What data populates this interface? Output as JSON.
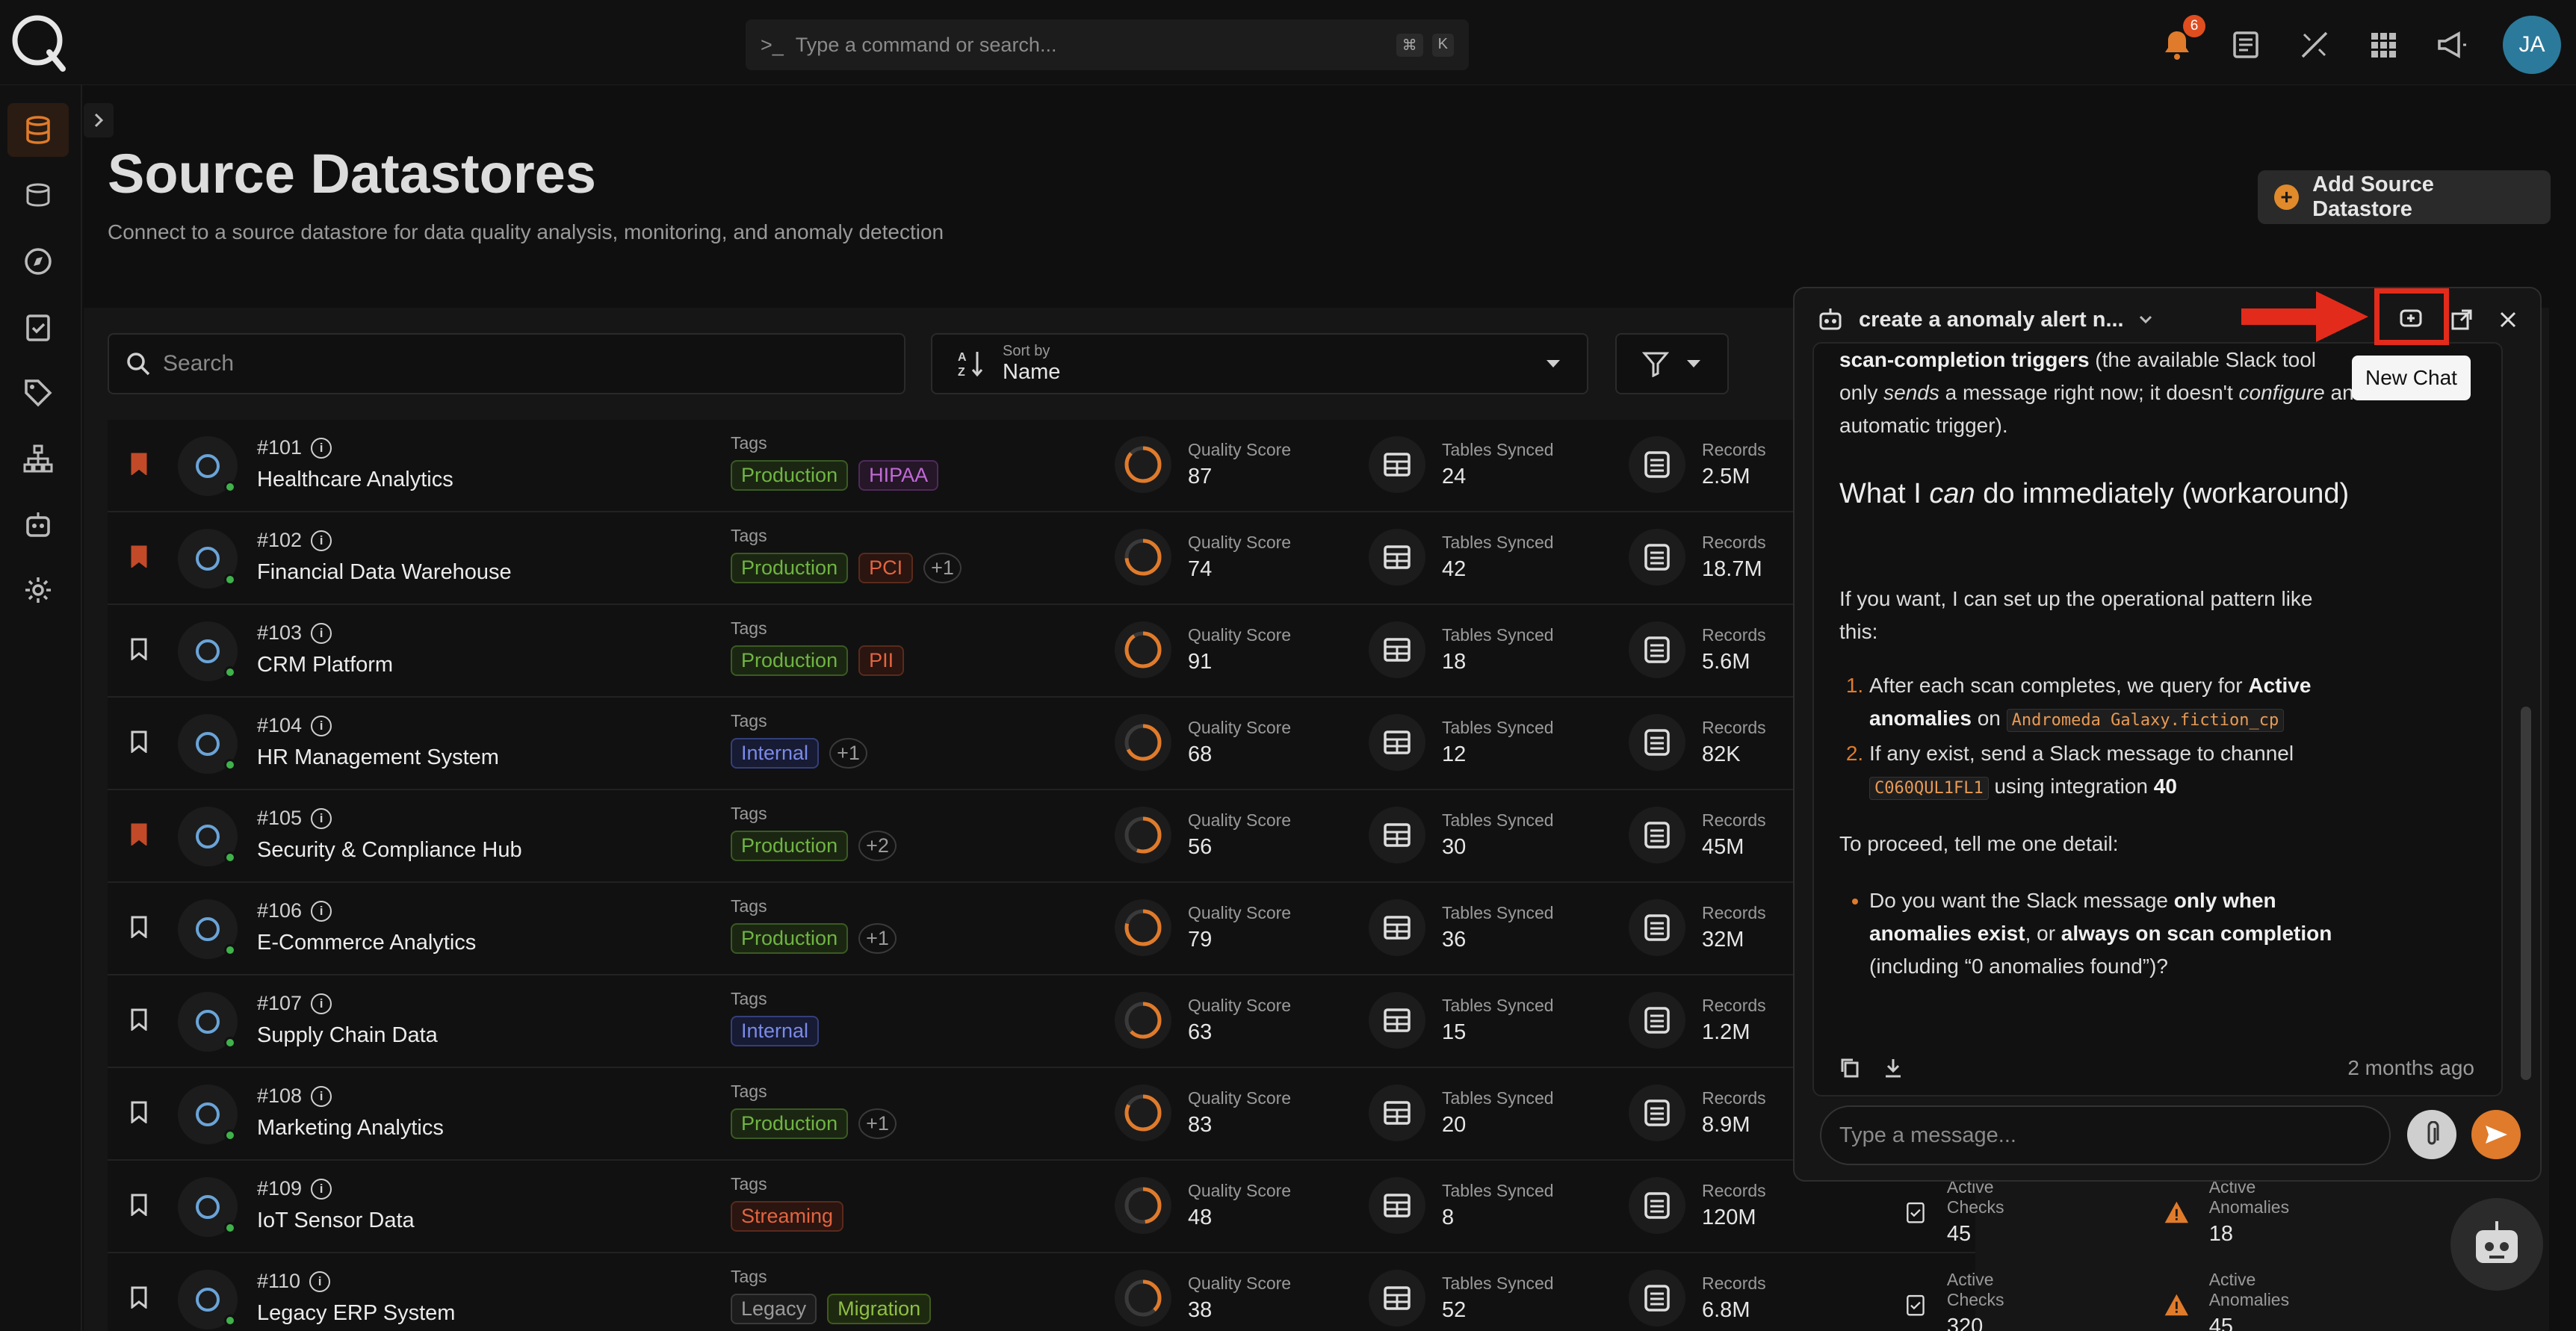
{
  "search": {
    "placeholder": "Type a command or search...",
    "key1": "⌘",
    "key2": "K"
  },
  "notifications": {
    "count": "6"
  },
  "user": {
    "initials": "JA"
  },
  "page": {
    "title": "Source Datastores",
    "subtitle": "Connect to a source datastore for data quality analysis, monitoring, and anomaly detection",
    "add_label": "Add Source Datastore"
  },
  "toolbar": {
    "search_placeholder": "Search",
    "sort_caption": "Sort by",
    "sort_value": "Name"
  },
  "labels": {
    "tags": "Tags",
    "quality": "Quality Score",
    "tables": "Tables Synced",
    "records": "Records",
    "checks": "Active Checks",
    "anomalies": "Active Anomalies"
  },
  "rows": [
    {
      "id": "#101",
      "name": "Healthcare Analytics",
      "bookmarked": true,
      "tags": [
        {
          "t": "Production",
          "c": "prod"
        },
        {
          "t": "HIPAA",
          "c": "hipaa"
        }
      ],
      "quality": "87",
      "tables": "24",
      "records": "2.5M"
    },
    {
      "id": "#102",
      "name": "Financial Data Warehouse",
      "bookmarked": true,
      "tags": [
        {
          "t": "Production",
          "c": "prod"
        },
        {
          "t": "PCI",
          "c": "pci"
        },
        {
          "t": "+1",
          "c": "more"
        }
      ],
      "quality": "74",
      "tables": "42",
      "records": "18.7M"
    },
    {
      "id": "#103",
      "name": "CRM Platform",
      "bookmarked": false,
      "tags": [
        {
          "t": "Production",
          "c": "prod"
        },
        {
          "t": "PII",
          "c": "pii"
        }
      ],
      "quality": "91",
      "tables": "18",
      "records": "5.6M"
    },
    {
      "id": "#104",
      "name": "HR Management System",
      "bookmarked": false,
      "tags": [
        {
          "t": "Internal",
          "c": "internal"
        },
        {
          "t": "+1",
          "c": "more"
        }
      ],
      "quality": "68",
      "tables": "12",
      "records": "82K"
    },
    {
      "id": "#105",
      "name": "Security & Compliance Hub",
      "bookmarked": true,
      "tags": [
        {
          "t": "Production",
          "c": "prod"
        },
        {
          "t": "+2",
          "c": "more"
        }
      ],
      "quality": "56",
      "tables": "30",
      "records": "45M"
    },
    {
      "id": "#106",
      "name": "E-Commerce Analytics",
      "bookmarked": false,
      "tags": [
        {
          "t": "Production",
          "c": "prod"
        },
        {
          "t": "+1",
          "c": "more"
        }
      ],
      "quality": "79",
      "tables": "36",
      "records": "32M"
    },
    {
      "id": "#107",
      "name": "Supply Chain Data",
      "bookmarked": false,
      "tags": [
        {
          "t": "Internal",
          "c": "internal"
        }
      ],
      "quality": "63",
      "tables": "15",
      "records": "1.2M"
    },
    {
      "id": "#108",
      "name": "Marketing Analytics",
      "bookmarked": false,
      "tags": [
        {
          "t": "Production",
          "c": "prod"
        },
        {
          "t": "+1",
          "c": "more"
        }
      ],
      "quality": "83",
      "tables": "20",
      "records": "8.9M"
    },
    {
      "id": "#109",
      "name": "IoT Sensor Data",
      "bookmarked": false,
      "tags": [
        {
          "t": "Streaming",
          "c": "streaming"
        }
      ],
      "quality": "48",
      "tables": "8",
      "records": "120M",
      "checks": "45",
      "anomalies": "18"
    },
    {
      "id": "#110",
      "name": "Legacy ERP System",
      "bookmarked": false,
      "tags": [
        {
          "t": "Legacy",
          "c": "legacy"
        },
        {
          "t": "Migration",
          "c": "migration"
        }
      ],
      "quality": "38",
      "tables": "52",
      "records": "6.8M",
      "checks": "320",
      "anomalies": "45"
    }
  ],
  "chat": {
    "title": "create a anomaly alert n...",
    "p1_b": "scan-completion triggers",
    "p1_a": " (the available Slack tool only ",
    "p1_i": "sends",
    "p1_c": " a message right now; it doesn't ",
    "p1_i2": "configure",
    "p1_d": " an automatic trigger).",
    "h_a": "What I ",
    "h_i": "can",
    "h_b": " do immediately (workaround)",
    "p2": "If you want, I can set up the operational pattern like this:",
    "li1_a": "After each scan completes, we query for ",
    "li1_b": "Active anomalies",
    "li1_c": " on ",
    "li1_code": "Andromeda Galaxy.fiction_cp",
    "li2_a": "If any exist, send a Slack message to channel ",
    "li2_code": "C060QUL1FL1",
    "li2_b": " using integration ",
    "li2_c": "40",
    "p3": "To proceed, tell me one detail:",
    "q_a": "Do you want the Slack message ",
    "q_b": "only when anomalies exist",
    "q_c": ", or ",
    "q_d": "always on scan completion",
    "q_e": " (including “0 anomalies found”)?",
    "timestamp": "2 months ago",
    "input_placeholder": "Type a message...",
    "tooltip": "New Chat"
  },
  "colors": {
    "accent": "#e07b2b",
    "highlight": "#e32b1b"
  }
}
